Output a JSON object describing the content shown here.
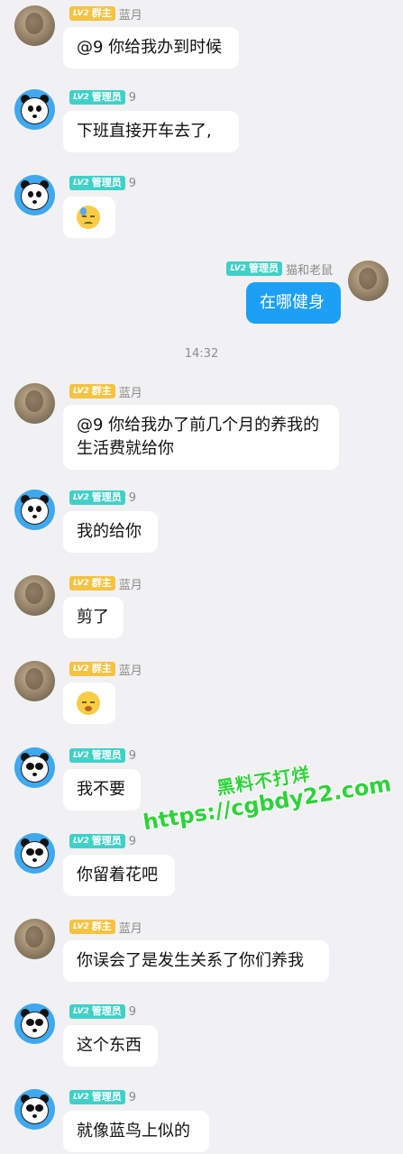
{
  "messages": [
    {
      "role": "群主",
      "level": "LV2",
      "nick": "蓝月",
      "text": "@9 你给我办到时候"
    },
    {
      "role": "管理员",
      "level": "LV2",
      "nick": "9",
      "text": "下班直接开车去了,"
    },
    {
      "role": "管理员",
      "level": "LV2",
      "nick": "9",
      "emoji": "sweat-sad-emoji"
    },
    {
      "role": "管理员",
      "level": "LV2",
      "nick": "猫和老鼠",
      "text": "在哪健身"
    },
    {
      "role": "群主",
      "level": "LV2",
      "nick": "蓝月",
      "text": "@9 你给我办了前几个月的养我的生活费就给你"
    },
    {
      "role": "管理员",
      "level": "LV2",
      "nick": "9",
      "text": "我的给你"
    },
    {
      "role": "群主",
      "level": "LV2",
      "nick": "蓝月",
      "text": "剪了"
    },
    {
      "role": "群主",
      "level": "LV2",
      "nick": "蓝月",
      "emoji": "yawn-emoji"
    },
    {
      "role": "管理员",
      "level": "LV2",
      "nick": "9",
      "text": "我不要"
    },
    {
      "role": "管理员",
      "level": "LV2",
      "nick": "9",
      "text": "你留着花吧"
    },
    {
      "role": "群主",
      "level": "LV2",
      "nick": "蓝月",
      "text": "你误会了是发生关系了你们养我"
    },
    {
      "role": "管理员",
      "level": "LV2",
      "nick": "9",
      "text": "这个东西"
    },
    {
      "role": "管理员",
      "level": "LV2",
      "nick": "9",
      "text": "就像蓝鸟上似的"
    }
  ],
  "timestamp": "14:32",
  "watermark": {
    "line1": "黑料不打烊",
    "line2": "https://cgbdy22.com"
  },
  "colors": {
    "owner_badge": "#f5c242",
    "admin_badge": "#3fd1c7",
    "my_bubble": "#1ba0f5",
    "background": "#f1f1f3",
    "watermark": "#2ed33a"
  }
}
